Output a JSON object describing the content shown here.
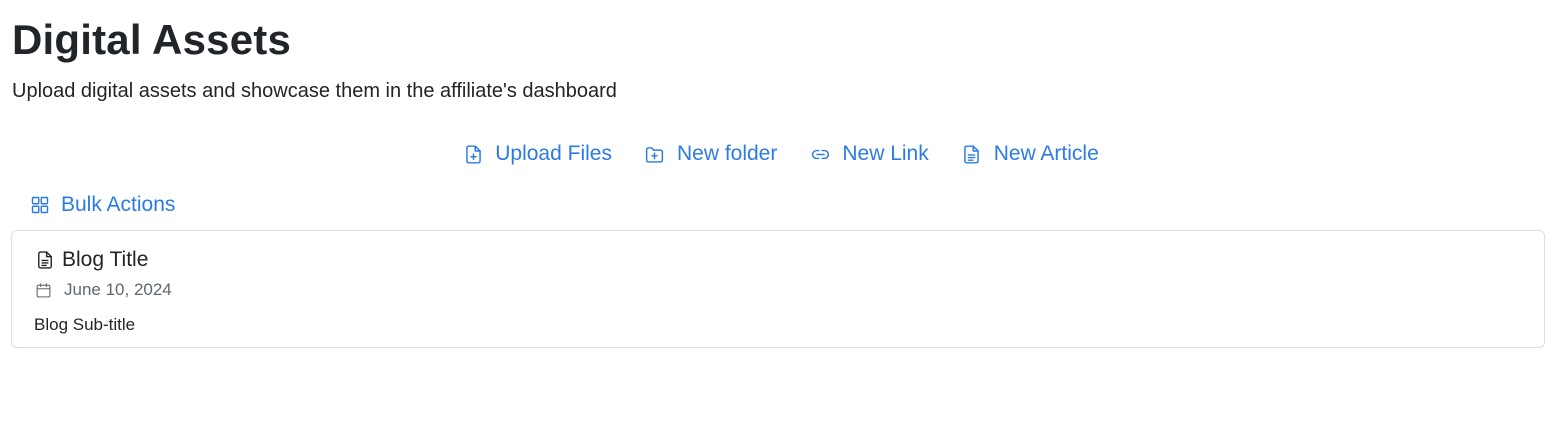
{
  "header": {
    "title": "Digital Assets",
    "subtitle": "Upload digital assets and showcase them in the affiliate's dashboard"
  },
  "toolbar": {
    "upload_files": "Upload Files",
    "new_folder": "New folder",
    "new_link": "New Link",
    "new_article": "New Article"
  },
  "bulk_actions": {
    "label": "Bulk Actions"
  },
  "assets": [
    {
      "type": "article",
      "icon": "document-icon",
      "title": "Blog Title",
      "date": "June 10, 2024",
      "subtitle": "Blog Sub-title"
    }
  ],
  "colors": {
    "accent": "#2c7be5",
    "text": "#212529",
    "muted": "#5f6770",
    "border": "#dcdfe3"
  }
}
